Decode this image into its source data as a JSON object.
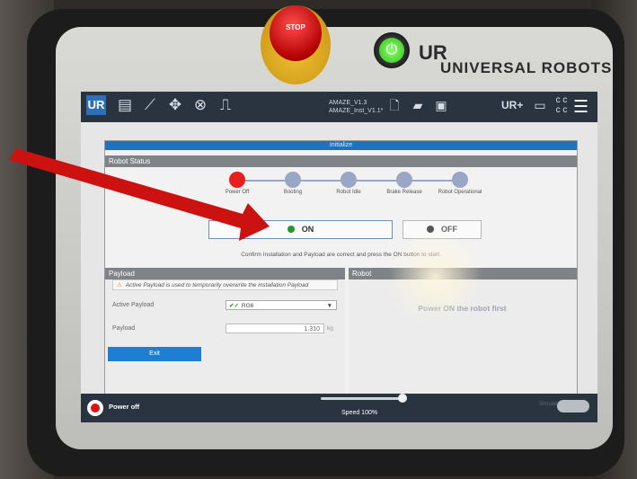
{
  "device": {
    "estop_label": "STOP",
    "power_symbol": "⏻",
    "brand_logo": "UR",
    "brand_text": "UNIVERSAL ROBOTS"
  },
  "topbar": {
    "logo": "UR",
    "program_name": "AMAZE_V1.3",
    "installation_name": "AMAZE_Inst_V1.1*",
    "icons": [
      "run-icon",
      "program-icon",
      "installation-icon",
      "move-icon",
      "io-icon",
      "log-icon",
      "new-icon",
      "open-icon",
      "save-icon",
      "urplus-icon",
      "manual-mode-icon",
      "cc-icon",
      "menu-icon"
    ]
  },
  "dialog": {
    "title": "Initialize",
    "robot_status_title": "Robot Status",
    "steps": [
      {
        "label": "Power Off",
        "active": true
      },
      {
        "label": "Booting",
        "active": false
      },
      {
        "label": "Robot Idle",
        "active": false
      },
      {
        "label": "Brake Release",
        "active": false
      },
      {
        "label": "Robot Operational",
        "active": false
      }
    ],
    "on_button": "ON",
    "off_button": "OFF",
    "confirm_text": "Confirm Installation and Payload are correct and press the ON button to start.",
    "payload_section": {
      "title": "Payload",
      "warning": "Active Payload is used to temporarily overwrite the installation Payload",
      "active_payload_label": "Active Payload",
      "active_payload_value": "RG6",
      "payload_label": "Payload",
      "payload_value": "1.310",
      "payload_unit": "kg"
    },
    "robot_section": {
      "title": "Robot",
      "message": "Power ON the robot first"
    },
    "exit_button": "Exit"
  },
  "bottombar": {
    "power_off_label": "Power off",
    "speed_label": "Speed 100%",
    "speed_value": 100,
    "simulation_label": "Simulation"
  },
  "colors": {
    "accent": "#1e73be",
    "topbar": "#2a3441",
    "on_led": "#1f9a2a",
    "off_led": "#555555",
    "power_off_step": "#e81e1e",
    "arrow": "#cc1111"
  }
}
